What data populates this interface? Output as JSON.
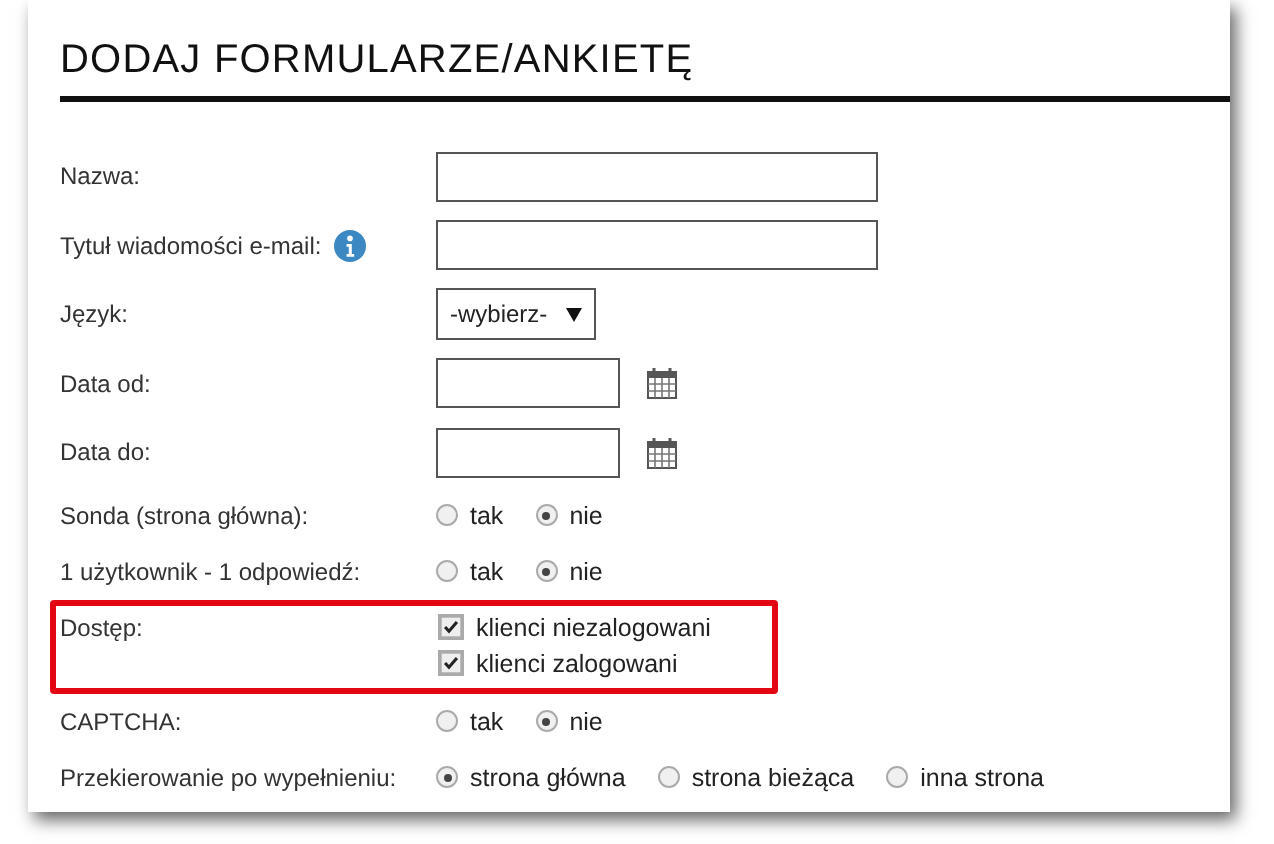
{
  "title": "DODAJ FORMULARZE/ANKIETĘ",
  "rows": [
    {
      "kind": "text",
      "label": "Nazwa:",
      "has_info": false,
      "highlighted": false
    },
    {
      "kind": "text",
      "label": "Tytuł wiadomości e-mail:",
      "has_info": true,
      "highlighted": false
    },
    {
      "kind": "select",
      "label": "Język:",
      "value": "-wybierz-",
      "has_info": false,
      "highlighted": false
    },
    {
      "kind": "date",
      "label": "Data od:",
      "has_info": false,
      "highlighted": false
    },
    {
      "kind": "date",
      "label": "Data do:",
      "has_info": false,
      "highlighted": false
    },
    {
      "kind": "radio",
      "label": "Sonda (strona główna):",
      "has_info": false,
      "highlighted": false,
      "options": [
        {
          "label": "tak",
          "selected": false
        },
        {
          "label": "nie",
          "selected": true
        }
      ]
    },
    {
      "kind": "radio",
      "label": "1 użytkownik - 1 odpowiedź:",
      "has_info": false,
      "highlighted": false,
      "options": [
        {
          "label": "tak",
          "selected": false
        },
        {
          "label": "nie",
          "selected": true
        }
      ]
    },
    {
      "kind": "checkbox",
      "label": "Dostęp:",
      "has_info": false,
      "highlighted": true,
      "options": [
        {
          "label": "klienci niezalogowani",
          "checked": true
        },
        {
          "label": "klienci zalogowani",
          "checked": true
        }
      ]
    },
    {
      "kind": "radio",
      "label": "CAPTCHA:",
      "has_info": false,
      "highlighted": false,
      "options": [
        {
          "label": "tak",
          "selected": false
        },
        {
          "label": "nie",
          "selected": true
        }
      ]
    },
    {
      "kind": "radio",
      "label": "Przekierowanie po wypełnieniu:",
      "has_info": false,
      "highlighted": false,
      "options": [
        {
          "label": "strona główna",
          "selected": true
        },
        {
          "label": "strona bieżąca",
          "selected": false
        },
        {
          "label": "inna strona",
          "selected": false
        }
      ]
    }
  ]
}
